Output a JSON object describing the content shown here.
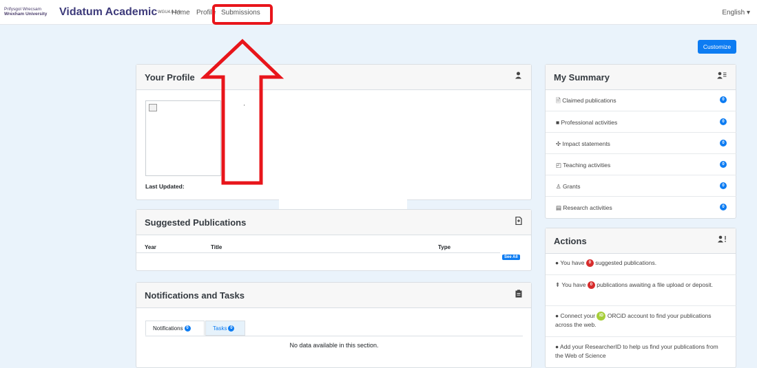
{
  "nav": {
    "brand_small_line1": "Prifysgol Wrecsam",
    "brand_small_line2": "Wrexham University",
    "brand": "Vidatum Academic",
    "version": "WGU4.0.2.0",
    "home": "Home",
    "profile": "Profile",
    "submissions": "Submissions",
    "language": "English ▾"
  },
  "customize_label": "Customize",
  "profile_card": {
    "title": "Your Profile",
    "last_updated_label": "Last Updated:"
  },
  "suggested": {
    "title": "Suggested Publications",
    "col_year": "Year",
    "col_title": "Title",
    "col_type": "Type",
    "see_all": "See All"
  },
  "notifications": {
    "title": "Notifications and Tasks",
    "tab_notifications": "Notifications",
    "tab_notifications_count": "0",
    "tab_tasks": "Tasks",
    "tab_tasks_count": "0",
    "no_data": "No data available in this section."
  },
  "summary": {
    "title": "My Summary",
    "items": [
      {
        "label": "Claimed publications",
        "count": "0",
        "icon": "file-icon"
      },
      {
        "label": "Professional activities",
        "count": "0",
        "icon": "briefcase-icon"
      },
      {
        "label": "Impact statements",
        "count": "0",
        "icon": "impact-icon"
      },
      {
        "label": "Teaching activities",
        "count": "0",
        "icon": "teaching-icon"
      },
      {
        "label": "Grants",
        "count": "0",
        "icon": "grants-icon"
      },
      {
        "label": "Research activities",
        "count": "0",
        "icon": "book-icon"
      }
    ]
  },
  "actions": {
    "title": "Actions",
    "items": [
      {
        "prefix": "You have",
        "count": "0",
        "suffix": "suggested publications."
      },
      {
        "prefix": "You have",
        "count": "0",
        "suffix": "publications awaiting a file upload or deposit."
      },
      {
        "prefix": "Connect your",
        "badge": "iD",
        "suffix": "ORCiD account to find your publications across the web."
      },
      {
        "prefix": "Add your ResearcherID to help us find your publications from the Web of Science"
      }
    ]
  },
  "colors": {
    "accent": "#0d7cf2",
    "highlight": "#e8151b",
    "danger": "#d72c2c",
    "orcid": "#a6ce39"
  }
}
